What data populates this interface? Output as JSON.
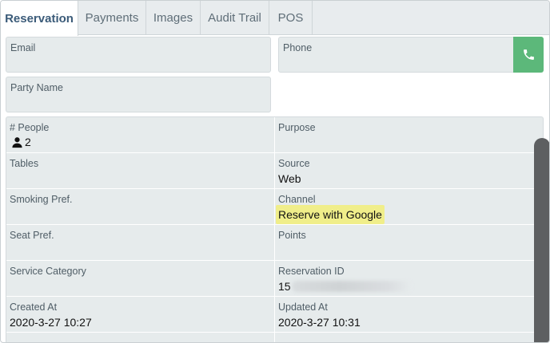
{
  "tabs": [
    {
      "label": "Reservation",
      "active": true
    },
    {
      "label": "Payments"
    },
    {
      "label": "Images"
    },
    {
      "label": "Audit Trail"
    },
    {
      "label": "POS"
    }
  ],
  "email": {
    "label": "Email",
    "value": ""
  },
  "phone": {
    "label": "Phone",
    "value": "",
    "button_icon": "phone-icon"
  },
  "party_name": {
    "label": "Party Name",
    "value": ""
  },
  "fields": {
    "people": {
      "label": "# People",
      "value": "2",
      "icon": "person-icon"
    },
    "purpose": {
      "label": "Purpose",
      "value": ""
    },
    "tables": {
      "label": "Tables",
      "value": ""
    },
    "source": {
      "label": "Source",
      "value": "Web"
    },
    "smoking": {
      "label": "Smoking Pref.",
      "value": ""
    },
    "channel": {
      "label": "Channel",
      "value": "Reserve with Google"
    },
    "seat": {
      "label": "Seat Pref.",
      "value": ""
    },
    "points": {
      "label": "Points",
      "value": ""
    },
    "service": {
      "label": "Service Category",
      "value": ""
    },
    "reservation_id": {
      "label": "Reservation ID",
      "value_prefix": "15"
    },
    "created": {
      "label": "Created At",
      "value": "2020-3-27 10:27"
    },
    "updated": {
      "label": "Updated At",
      "value": "2020-3-27 10:31"
    }
  },
  "colors": {
    "accent": "#3b5b79",
    "phone_button": "#5cb87a",
    "highlight": "#f0ee8a"
  }
}
